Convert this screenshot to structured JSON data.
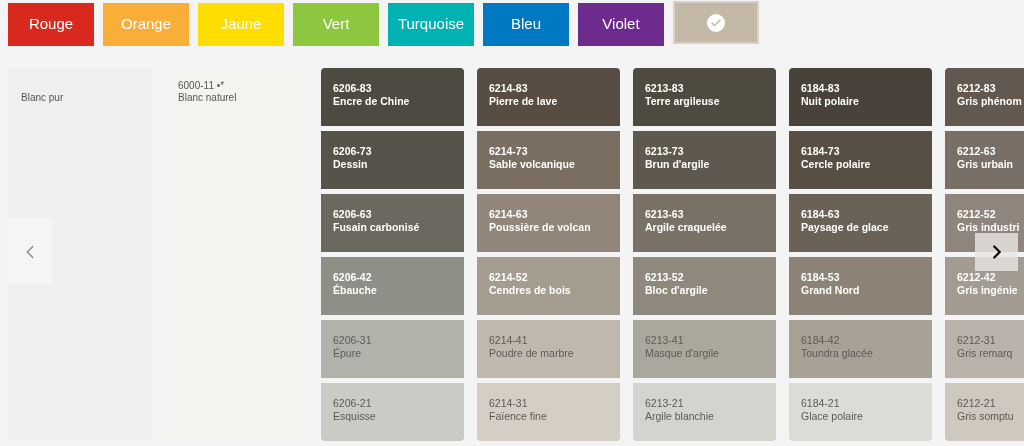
{
  "filters": [
    {
      "kind": "label",
      "label": "Rouge",
      "color": "#d9281e",
      "selected": false
    },
    {
      "kind": "label",
      "label": "Orange",
      "color": "#f9ae37",
      "selected": false
    },
    {
      "kind": "label",
      "label": "Jaune",
      "color": "#fedd00",
      "selected": false
    },
    {
      "kind": "label",
      "label": "Vert",
      "color": "#8dc63f",
      "selected": false
    },
    {
      "kind": "label",
      "label": "Turquoise",
      "color": "#00b2b2",
      "selected": false
    },
    {
      "kind": "label",
      "label": "Bleu",
      "color": "#0079c2",
      "selected": false
    },
    {
      "kind": "label",
      "label": "Violet",
      "color": "#6d2b8e",
      "selected": false
    },
    {
      "kind": "check",
      "color": "#c4b9a7",
      "selected": true
    }
  ],
  "neutral_columns": [
    {
      "color": "#efefed",
      "lines": [
        "Blanc pur"
      ]
    },
    {
      "color": "#f4f3ef",
      "lines": [
        "6000-11 •*",
        "Blanc naturel"
      ]
    }
  ],
  "swatch_columns": [
    {
      "swatches": [
        {
          "code": "6206-83",
          "name": "Encre de Chine",
          "color": "#4d4a41"
        },
        {
          "code": "6206-73",
          "name": "Dessin",
          "color": "#55534a"
        },
        {
          "code": "6206-63",
          "name": "Fusain carbonisé",
          "color": "#6b685f"
        },
        {
          "code": "6206-42",
          "name": "Ébauche",
          "color": "#908f87"
        },
        {
          "code": "6206-31",
          "name": "Épure",
          "color": "#b3b2aa"
        },
        {
          "code": "6206-21",
          "name": "Esquisse",
          "color": "#cacbc4"
        }
      ]
    },
    {
      "swatches": [
        {
          "code": "6214-83",
          "name": "Pierre de lave",
          "color": "#574d43"
        },
        {
          "code": "6214-73",
          "name": "Sable volcanique",
          "color": "#7a6e61"
        },
        {
          "code": "6214-63",
          "name": "Poussière de volcan",
          "color": "#918679"
        },
        {
          "code": "6214-52",
          "name": "Cendres de bois",
          "color": "#a59c90"
        },
        {
          "code": "6214-41",
          "name": "Poudre de marbre",
          "color": "#c0b8ad"
        },
        {
          "code": "6214-31",
          "name": "Faïence fine",
          "color": "#d5cec4"
        }
      ]
    },
    {
      "swatches": [
        {
          "code": "6213-83",
          "name": "Terre argileuse",
          "color": "#4f4a40"
        },
        {
          "code": "6213-73",
          "name": "Brun d'argile",
          "color": "#5f584e"
        },
        {
          "code": "6213-63",
          "name": "Argile craquelée",
          "color": "#7a7166"
        },
        {
          "code": "6213-52",
          "name": "Bloc d'argile",
          "color": "#8e887d"
        },
        {
          "code": "6213-41",
          "name": "Masque d'argile",
          "color": "#aca79c"
        },
        {
          "code": "6213-21",
          "name": "Argile blanchie",
          "color": "#d4d4ce"
        }
      ]
    },
    {
      "swatches": [
        {
          "code": "6184-83",
          "name": "Nuit polaire",
          "color": "#48423a"
        },
        {
          "code": "6184-73",
          "name": "Cercle polaire",
          "color": "#574e44"
        },
        {
          "code": "6184-63",
          "name": "Paysage de glace",
          "color": "#6a6157"
        },
        {
          "code": "6184-53",
          "name": "Grand Nord",
          "color": "#8c8276"
        },
        {
          "code": "6184-42",
          "name": "Toundra glacée",
          "color": "#a8a196"
        },
        {
          "code": "6184-21",
          "name": "Glace polaire",
          "color": "#dcdbd6"
        }
      ]
    },
    {
      "swatches": [
        {
          "code": "6212-83",
          "name": "Gris phénom",
          "color": "#625850"
        },
        {
          "code": "6212-63",
          "name": "Gris urbain",
          "color": "#7a6f66"
        },
        {
          "code": "6212-52",
          "name": "Gris industri",
          "color": "#8f857c"
        },
        {
          "code": "6212-42",
          "name": "Gris ingénie",
          "color": "#a39a92"
        },
        {
          "code": "6212-31",
          "name": "Gris remarq",
          "color": "#bab2aa"
        },
        {
          "code": "6212-21",
          "name": "Gris somptu",
          "color": "#cfc8bf"
        }
      ]
    }
  ]
}
